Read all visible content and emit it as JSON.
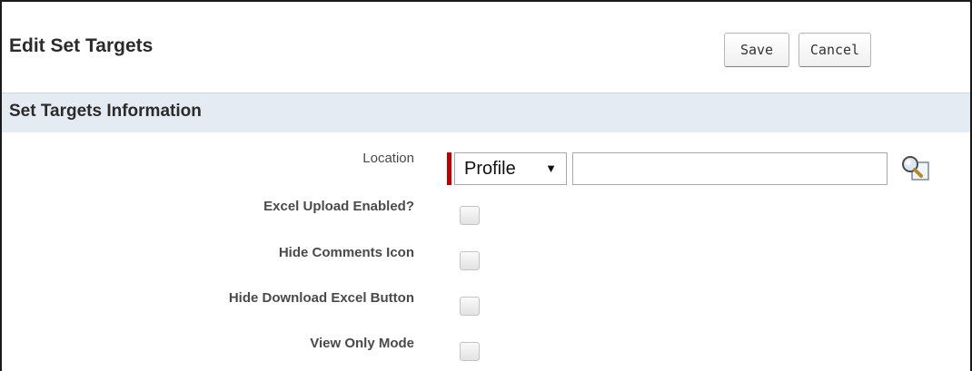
{
  "header": {
    "title": "Edit Set Targets",
    "save_label": "Save",
    "cancel_label": "Cancel"
  },
  "section": {
    "title": "Set Targets Information"
  },
  "fields": {
    "location": {
      "label": "Location",
      "select_value": "Profile",
      "select_arrow": "▼",
      "input_value": "",
      "lookup_icon": "magnifier-lookup-icon",
      "required": true
    },
    "excel_upload": {
      "label": "Excel Upload Enabled?",
      "checked": false
    },
    "hide_comments": {
      "label": "Hide Comments Icon",
      "checked": false
    },
    "hide_download": {
      "label": "Hide Download Excel Button",
      "checked": false
    },
    "view_only": {
      "label": "View Only Mode",
      "checked": false
    }
  },
  "colors": {
    "section_bg": "#e5ebf2",
    "required_bar": "#c00000"
  }
}
